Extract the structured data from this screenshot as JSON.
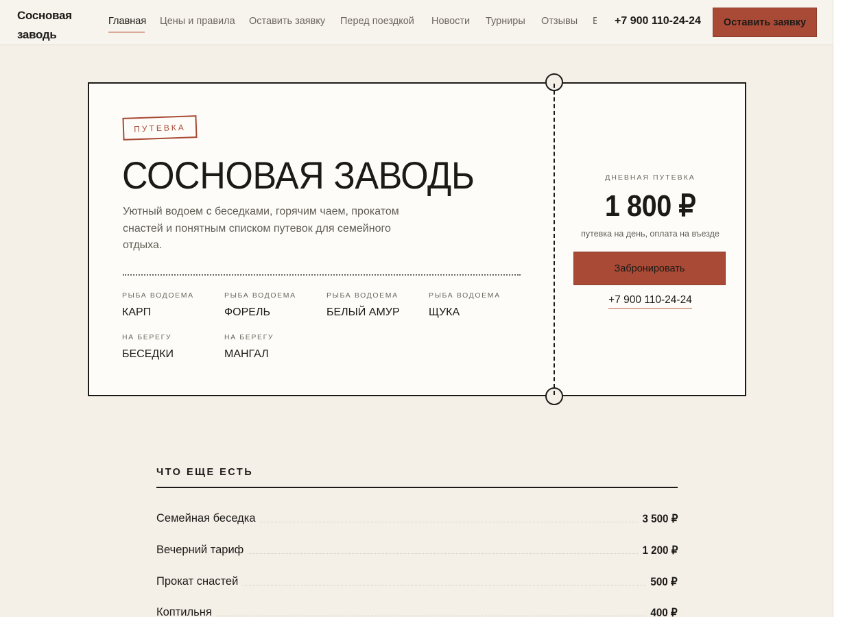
{
  "header": {
    "logo": "Сосновая заводь",
    "nav": [
      {
        "label": "Главная",
        "active": true
      },
      {
        "label": "Цены и правила"
      },
      {
        "label": "Оставить заявку"
      },
      {
        "label": "Перед поездкой"
      },
      {
        "label": "Новости"
      },
      {
        "label": "Турниры"
      },
      {
        "label": "Отзывы"
      },
      {
        "label": "В"
      }
    ],
    "phone": "+7 900 110-24-24",
    "cta": "Оставить заявку"
  },
  "ticket": {
    "stamp": "ПУТЕВКА",
    "title": "СОСНОВАЯ ЗАВОДЬ",
    "description": "Уютный водоем с беседками, горячим чаем, прокатом снастей и понятным списком путевок для семейного отдыха.",
    "features": [
      {
        "label": "РЫБА ВОДОЕМА",
        "value": "КАРП"
      },
      {
        "label": "РЫБА ВОДОЕМА",
        "value": "ФОРЕЛЬ"
      },
      {
        "label": "РЫБА ВОДОЕМА",
        "value": "БЕЛЫЙ АМУР"
      },
      {
        "label": "РЫБА ВОДОЕМА",
        "value": "ЩУКА"
      },
      {
        "label": "НА БЕРЕГУ",
        "value": "БЕСЕДКИ"
      },
      {
        "label": "НА БЕРЕГУ",
        "value": "МАНГАЛ"
      }
    ],
    "stub": {
      "label": "ДНЕВНАЯ ПУТЕВКА",
      "price": "1 800 ₽",
      "note": "путевка на день, оплата на въезде",
      "button": "Забронировать",
      "phone": "+7 900 110-24-24"
    }
  },
  "extras": {
    "title": "ЧТО ЕЩЕ ЕСТЬ",
    "items": [
      {
        "name": "Семейная беседка",
        "price": "3 500 ₽"
      },
      {
        "name": "Вечерний тариф",
        "price": "1 200 ₽"
      },
      {
        "name": "Прокат снастей",
        "price": "500 ₽"
      },
      {
        "name": "Коптильня",
        "price": "400 ₽"
      }
    ]
  },
  "colors": {
    "accent": "#a84a36",
    "background": "#f4f0e8",
    "ticket": "#fdfcf8",
    "text": "#1c1a17"
  }
}
